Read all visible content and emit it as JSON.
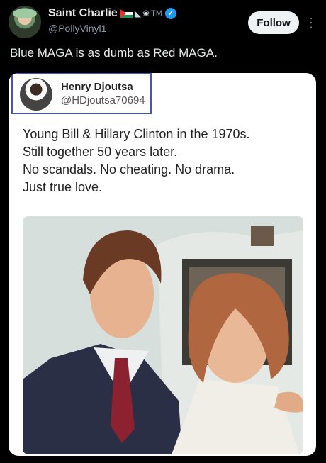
{
  "author": {
    "name": "Saint Charlie",
    "badge_text": "TM",
    "handle": "@PollyVinyl1",
    "verified": true
  },
  "actions": {
    "follow_label": "Follow",
    "more_icon": "more-vertical-icon"
  },
  "post": {
    "text": "Blue MAGA is as dumb as Red MAGA."
  },
  "quoted": {
    "name": "Henry Djoutsa",
    "handle": "@HDjoutsa70694",
    "lines": [
      "Young Bill & Hillary Clinton in the 1970s.",
      "Still together 50 years later.",
      "No scandals. No cheating. No drama.",
      "Just true love."
    ]
  },
  "colors": {
    "background": "#000000",
    "accent": "#1d9bf0",
    "quote_border": "#4756a6"
  }
}
